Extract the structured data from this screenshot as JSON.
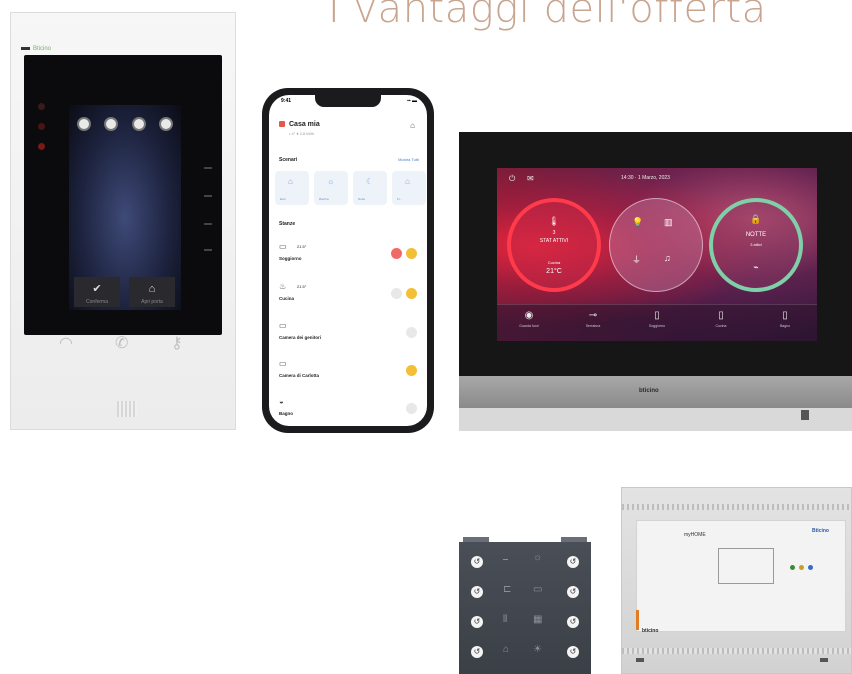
{
  "headline": "I vantaggi dell'offerta",
  "door_panel": {
    "brand": "Bticino",
    "button_left_label": "Conferma",
    "button_right_label": "Apri porta"
  },
  "phone": {
    "status_time": "9:41",
    "home_title": "Casa mia",
    "home_sub": "• 4° ♦ 2.8 kWh",
    "scenari_title": "Scenari",
    "scenari_link": "Mostra Tutti",
    "scenes": [
      "Esci",
      "Rientra",
      "Notte",
      "Fi..."
    ],
    "stanze_title": "Stanze",
    "rooms": [
      {
        "name": "Soggiorno",
        "temp": "21.5°",
        "badges": [
          "red",
          "yellow"
        ]
      },
      {
        "name": "Cucina",
        "temp": "21.5°",
        "badges": [
          "grey",
          "yellow"
        ]
      },
      {
        "name": "Camera dei genitori",
        "temp": "",
        "badges": [
          "grey"
        ]
      },
      {
        "name": "Camera di Carlotta",
        "temp": "",
        "badges": [
          "yellow"
        ]
      },
      {
        "name": "Bagno",
        "temp": "",
        "badges": [
          "grey"
        ]
      }
    ]
  },
  "station": {
    "clock": "14:30 · 1 Marzo, 2023",
    "ring_left": {
      "line1": "3",
      "line2": "STAT ATTIVI",
      "temp_label": "Cucina",
      "temp": "21°C"
    },
    "ring_right": {
      "line1": "NOTTE",
      "line2": "3 attivi"
    },
    "dock": [
      {
        "label": "Guarda fuori",
        "icon": "eye-icon"
      },
      {
        "label": "Serratura",
        "icon": "key-icon"
      },
      {
        "label": "Soggiorno",
        "icon": "door-icon"
      },
      {
        "label": "Cucina",
        "icon": "door-icon"
      },
      {
        "label": "Bagno",
        "icon": "door-icon"
      }
    ],
    "brand": "bticino"
  },
  "din_module": {
    "label": "myHOME",
    "logo": "Bticino",
    "brand": "bticino"
  },
  "colors": {
    "headline": "#c9a590",
    "accent_red": "#e7253e",
    "accent_green": "#7fd0a8",
    "phone_yellow": "#f2bf35",
    "phone_red": "#ef6a67",
    "din_orange": "#e27b23"
  }
}
